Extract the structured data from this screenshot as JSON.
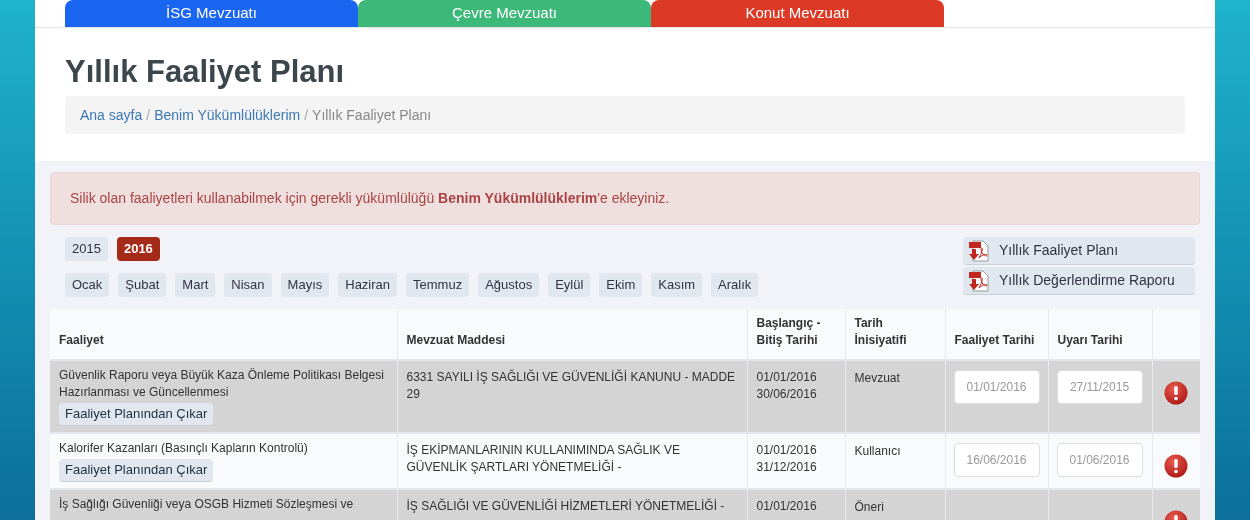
{
  "tabs": [
    {
      "label": "İSG Mevzuatı",
      "color": "#1a66f0"
    },
    {
      "label": "Çevre Mevzuatı",
      "color": "#3cb878"
    },
    {
      "label": "Konut Mevzuatı",
      "color": "#dc3a26"
    }
  ],
  "page_title": "Yıllık Faaliyet Planı",
  "breadcrumb_separator": "/",
  "breadcrumb": [
    {
      "label": "Ana sayfa",
      "kind": "link"
    },
    {
      "label": "Benim Yükümlülüklerim",
      "kind": "link"
    },
    {
      "label": "Yıllık Faaliyet Planı",
      "kind": "current"
    }
  ],
  "alert": "Silik olan faaliyetleri kullanabilmek için gerekli yükümlülüğü **Benim Yükümlülüklerim**'e ekleyiniz.",
  "years": [
    {
      "label": "2015",
      "selected": false
    },
    {
      "label": "2016",
      "selected": true
    }
  ],
  "months": [
    {
      "label": "Ocak",
      "selected": false
    },
    {
      "label": "Şubat",
      "selected": false
    },
    {
      "label": "Mart",
      "selected": false
    },
    {
      "label": "Nisan",
      "selected": false
    },
    {
      "label": "Mayıs",
      "selected": false
    },
    {
      "label": "Haziran",
      "selected": false
    },
    {
      "label": "Temmuz",
      "selected": false
    },
    {
      "label": "Ağustos",
      "selected": false
    },
    {
      "label": "Eylül",
      "selected": false
    },
    {
      "label": "Ekim",
      "selected": false
    },
    {
      "label": "Kasım",
      "selected": false
    },
    {
      "label": "Aralık",
      "selected": false
    }
  ],
  "reports": [
    "Yıllık Faaliyet Planı",
    "Yıllık Değerlendirme Raporu"
  ],
  "table": {
    "columns": [
      "Faaliyet",
      "Mevzuat Maddesi",
      "Başlangıç - Bitiş Tarihi",
      "Tarih İnisiyatifi",
      "Faaliyet Tarihi",
      "Uyarı Tarihi"
    ],
    "rows": [
      {
        "activity": "Güvenlik Raporu veya Büyük Kaza Önleme Politikası Belgesi Hazırlanması ve Güncellenmesi",
        "remove_button": "Faaliyet Planından Çıkar",
        "article": "6331 SAYILI İŞ SAĞLIĞI VE GÜVENLİĞİ KANUNU - MADDE 29",
        "start": "01/01/2016",
        "end": "30/06/2016",
        "initiative": "Mevzuat",
        "activity_date": "01/01/2016",
        "warning_date": "27/11/2015",
        "warning": true
      },
      {
        "activity": "Kalorifer Kazanları (Basınçlı Kapların Kontrolü)",
        "remove_button": "Faaliyet Planından Çıkar",
        "article": "İŞ EKİPMANLARININ KULLANIMINDA SAĞLIK VE GÜVENLİK ŞARTLARI YÖNETMELİĞİ -",
        "start": "01/01/2016",
        "end": "31/12/2016",
        "initiative": "Kullanıcı",
        "activity_date": "16/06/2016",
        "warning_date": "01/06/2016",
        "warning": true
      },
      {
        "activity": "İş Sağlığı Güvenliği veya OSGB Hizmeti Sözleşmesi ve",
        "article": "İŞ SAĞLIĞI VE GÜVENLİĞİ HİZMETLERİ YÖNETMELİĞİ -",
        "start": "01/01/2016",
        "initiative": "Öneri",
        "warning": true
      }
    ]
  }
}
